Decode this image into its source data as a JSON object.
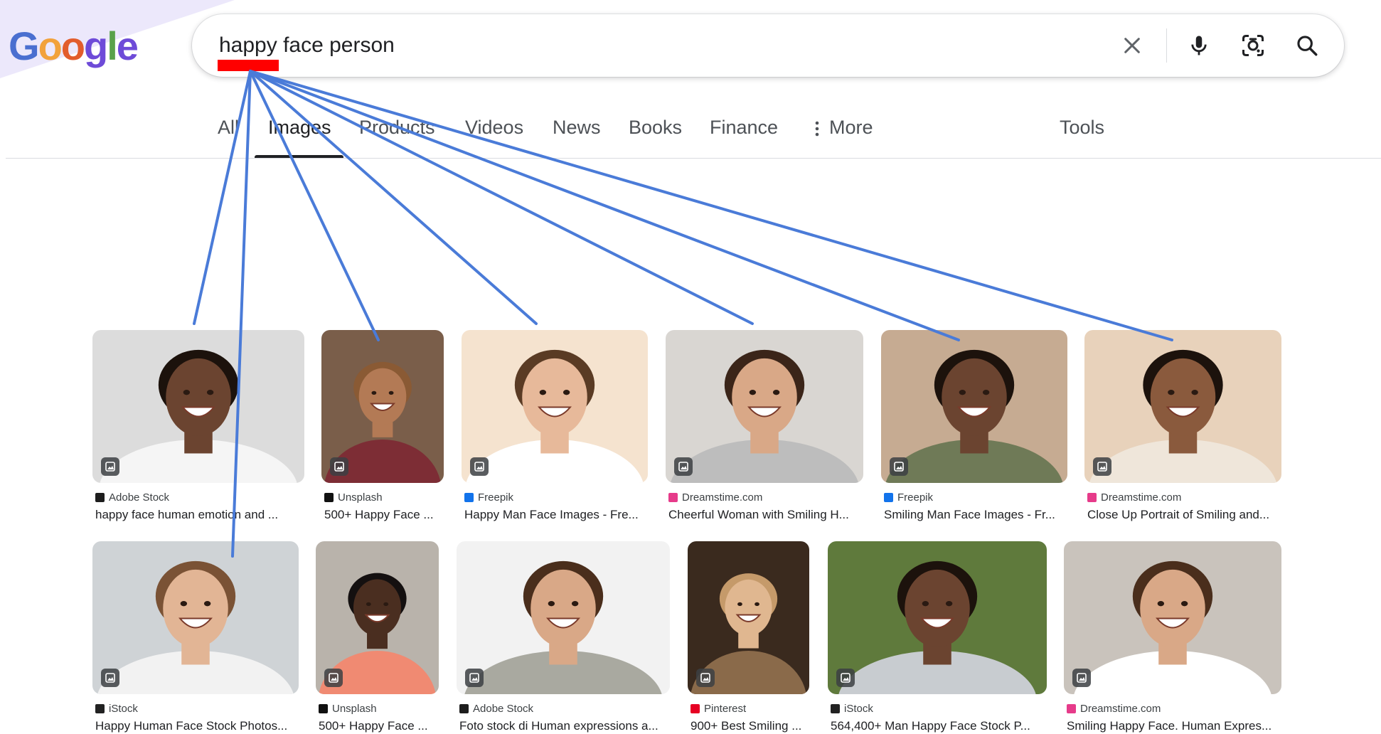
{
  "logo": {
    "letters": [
      "G",
      "o",
      "o",
      "g",
      "l",
      "e"
    ],
    "colors": [
      "#4a6fd0",
      "#f2a23b",
      "#e25d2c",
      "#6e4bd8",
      "#5aa24a",
      "#6e4bd8"
    ]
  },
  "search": {
    "value": "happy face person",
    "clear_icon": "close-icon",
    "voice_icon": "microphone-icon",
    "lens_icon": "camera-lens-icon",
    "search_icon": "search-icon"
  },
  "tabs": {
    "all": "All",
    "images": "Images",
    "products": "Products",
    "videos": "Videos",
    "news": "News",
    "books": "Books",
    "finance": "Finance",
    "more": "More",
    "tools": "Tools",
    "active": "Images"
  },
  "results": [
    {
      "source": "Adobe Stock",
      "title": "happy face human emotion and ...",
      "favicon_color": "#1d1d1d",
      "icon": "adobe-stock-icon",
      "bg": "#dcdcdc",
      "skin": "#6b4430",
      "hair": "#1c120c",
      "shirt": "#f5f5f5"
    },
    {
      "source": "Unsplash",
      "title": "500+ Happy Face ...",
      "favicon_color": "#111111",
      "icon": "unsplash-icon",
      "bg": "#7a5e4a",
      "skin": "#b37a55",
      "hair": "#8a5a34",
      "shirt": "#7d2d35"
    },
    {
      "source": "Freepik",
      "title": "Happy Man Face Images - Fre...",
      "favicon_color": "#1273eb",
      "icon": "freepik-icon",
      "bg": "#f5e3cf",
      "skin": "#e7b99a",
      "hair": "#5a3b24",
      "shirt": "#ffffff"
    },
    {
      "source": "Dreamstime.com",
      "title": "Cheerful Woman with Smiling H...",
      "favicon_color": "#e63b8a",
      "icon": "dreamstime-icon",
      "bg": "#d9d6d2",
      "skin": "#d9a887",
      "hair": "#3b2519",
      "shirt": "#bdbdbd"
    },
    {
      "source": "Freepik",
      "title": "Smiling Man Face Images - Fr...",
      "favicon_color": "#1273eb",
      "icon": "freepik-icon",
      "bg": "#c6ab92",
      "skin": "#6b4430",
      "hair": "#1c120c",
      "shirt": "#6f7a57"
    },
    {
      "source": "Dreamstime.com",
      "title": "Close Up Portrait of Smiling and...",
      "favicon_color": "#e63b8a",
      "icon": "dreamstime-icon",
      "bg": "#e8d2bb",
      "skin": "#8a5a3d",
      "hair": "#1c120c",
      "shirt": "#efe6da"
    },
    {
      "source": "iStock",
      "title": "Happy Human Face Stock Photos...",
      "favicon_color": "#222222",
      "icon": "istock-icon",
      "bg": "#cfd3d6",
      "skin": "#e2b595",
      "hair": "#7a5235",
      "shirt": "#f2f2f2"
    },
    {
      "source": "Unsplash",
      "title": "500+ Happy Face ...",
      "favicon_color": "#111111",
      "icon": "unsplash-icon",
      "bg": "#b9b3ab",
      "skin": "#4a2e20",
      "hair": "#141010",
      "shirt": "#f08a72"
    },
    {
      "source": "Adobe Stock",
      "title": "Foto stock di Human expressions a...",
      "favicon_color": "#1d1d1d",
      "icon": "adobe-stock-icon",
      "bg": "#f2f2f2",
      "skin": "#d9a887",
      "hair": "#4a2e1c",
      "shirt": "#a9a9a0"
    },
    {
      "source": "Pinterest",
      "title": "900+ Best Smiling ...",
      "favicon_color": "#e60023",
      "icon": "pinterest-icon",
      "bg": "#3a2a1e",
      "skin": "#e0b790",
      "hair": "#c59a6a",
      "shirt": "#8a6a4a"
    },
    {
      "source": "iStock",
      "title": "564,400+ Man Happy Face Stock P...",
      "favicon_color": "#222222",
      "icon": "istock-icon",
      "bg": "#5f7a3c",
      "skin": "#6b4430",
      "hair": "#1c120c",
      "shirt": "#c8ccd0"
    },
    {
      "source": "Dreamstime.com",
      "title": "Smiling Happy Face. Human Expres...",
      "favicon_color": "#e63b8a",
      "icon": "dreamstime-icon",
      "bg": "#c9c3bc",
      "skin": "#d9a887",
      "hair": "#4a2e1c",
      "shirt": "#ffffff"
    }
  ],
  "annotation": {
    "line_color": "#4a7bd8",
    "mark_color": "#ff0000"
  }
}
